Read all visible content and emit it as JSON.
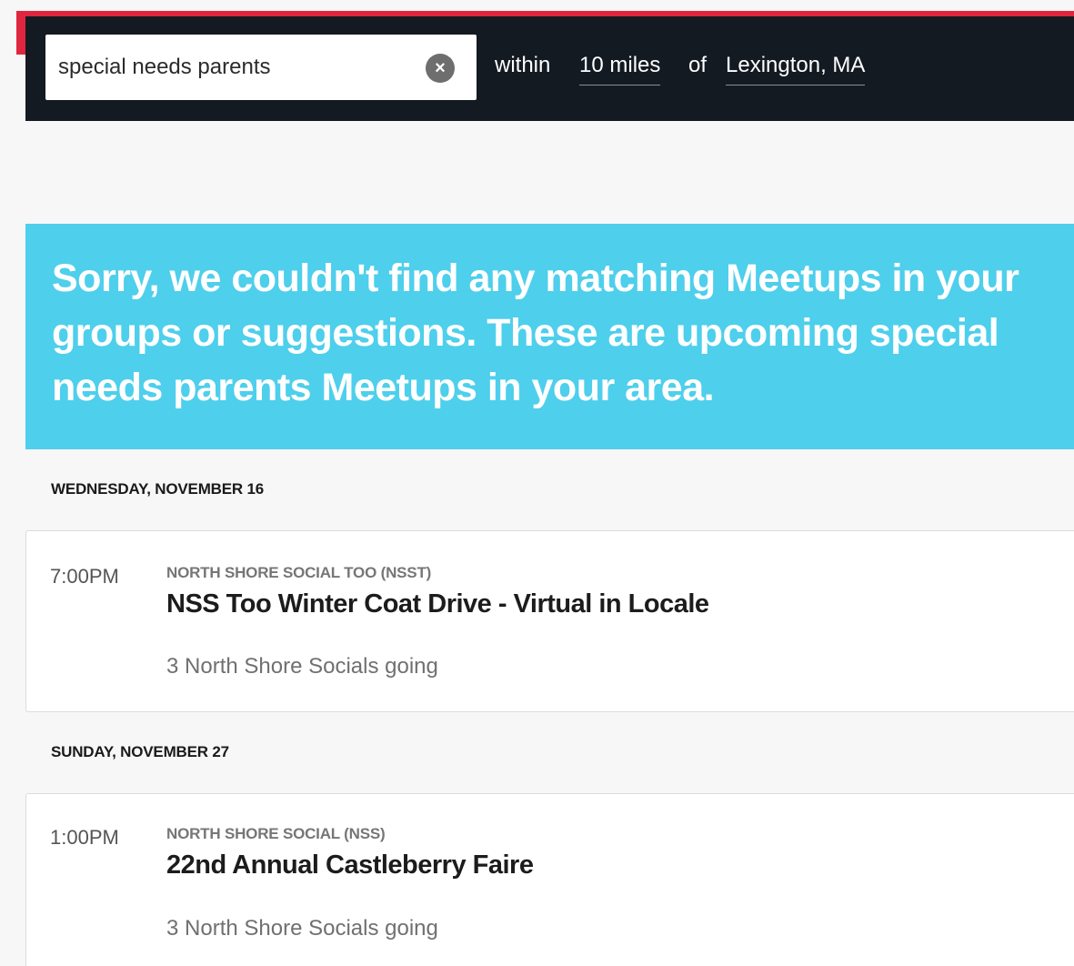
{
  "search": {
    "query": "special needs parents",
    "clear_icon": "close-icon",
    "within_label": "within",
    "radius": "10 miles",
    "of_label": "of",
    "location": "Lexington, MA"
  },
  "banner": {
    "message": "Sorry, we couldn't find any matching Meetups in your groups or suggestions. These are upcoming special needs parents Meetups in your area."
  },
  "events": [
    {
      "date": "WEDNESDAY, NOVEMBER 16",
      "time": "7:00PM",
      "group": "NORTH SHORE SOCIAL TOO (NSST)",
      "title": "NSS Too Winter Coat Drive - Virtual in Locale",
      "attendees": "3 North Shore Socials going"
    },
    {
      "date": "SUNDAY, NOVEMBER 27",
      "time": "1:00PM",
      "group": "NORTH SHORE SOCIAL (NSS)",
      "title": "22nd Annual Castleberry Faire",
      "attendees": "3 North Shore Socials going"
    }
  ],
  "colors": {
    "accent": "#e0263f",
    "search_bar_bg": "#141a22",
    "banner_bg": "#4ecfec"
  }
}
